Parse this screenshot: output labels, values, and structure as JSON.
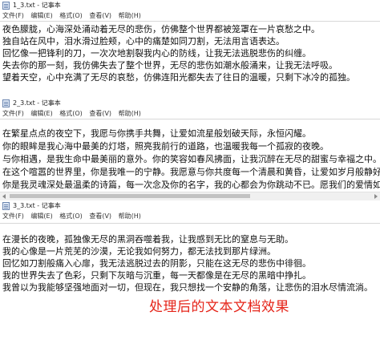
{
  "windows": [
    {
      "title": "1_3.txt - 记事本",
      "menu": [
        "文件(F)",
        "编辑(E)",
        "格式(O)",
        "查看(V)",
        "帮助(H)"
      ],
      "lines": [
        "夜色朦胧，心海深处涌动着无尽的悲伤，仿佛整个世界都被笼罩在一片哀愁之中。",
        "独自站在风中，泪水滑过脸颊，心中的痛楚如同刀割，无法用言语表达。",
        "回忆像一把锋利的刀，一次次地割裂我内心的防线，让我无法逃脱悲伤的纠缠。",
        "失去你的那一刻，我仿佛失去了整个世界，无尽的悲伤如潮水般涌来，让我无法呼吸。",
        "望着天空，心中充满了无尽的哀愁，仿佛连阳光都失去了往日的温暖，只剩下冰冷的孤独。"
      ]
    },
    {
      "title": "2_3.txt - 记事本",
      "menu": [
        "文件(F)",
        "编辑(E)",
        "格式(O)",
        "查看(V)",
        "帮助(H)"
      ],
      "lines": [
        "在繁星点点的夜空下，我愿与你携手共舞，让爱如流星般划破天际，永恒闪耀。",
        "你的眼眸是我心海中最美的灯塔，照亮我前行的道路，也温暖我每一个孤寂的夜晚。",
        "与你相遇，是我生命中最美丽的意外。你的笑容如春风拂面，让我沉醉在无尽的甜蜜与幸福之中。",
        "在这个喧嚣的世界里，你是我唯一的宁静。我愿意与你共度每一个清晨和黄昏，让爱如岁月般静好。",
        "你是我灵魂深处最温柔的诗篇，每一次念及你的名字，我的心都会为你跳动不已。愿我们的爱情如"
      ]
    },
    {
      "title": "3_3.txt - 记事本",
      "menu": [
        "文件(F)",
        "编辑(E)",
        "格式(O)",
        "查看(V)",
        "帮助(H)"
      ],
      "lines": [
        "在漫长的夜晚，孤独像无尽的黑洞吞噬着我，让我感到无比的窒息与无助。",
        "我的心像是一片荒芜的沙漠，无论我如何努力，都无法找到那片绿洲。",
        "回忆如刀割般痛入心扉，我无法逃脱过去的阴影，只能在这无尽的悲伤中徘徊。",
        "我的世界失去了色彩，只剩下灰暗与沉重，每一天都像是在无尽的黑暗中挣扎。",
        "我曾以为我能够坚强地面对一切，但现在，我只想找一个安静的角落，让悲伤的泪水尽情流淌。"
      ]
    }
  ],
  "caption": "处理后的文本文档效果",
  "colors": {
    "caption": "#e5251a",
    "text": "#111111"
  }
}
